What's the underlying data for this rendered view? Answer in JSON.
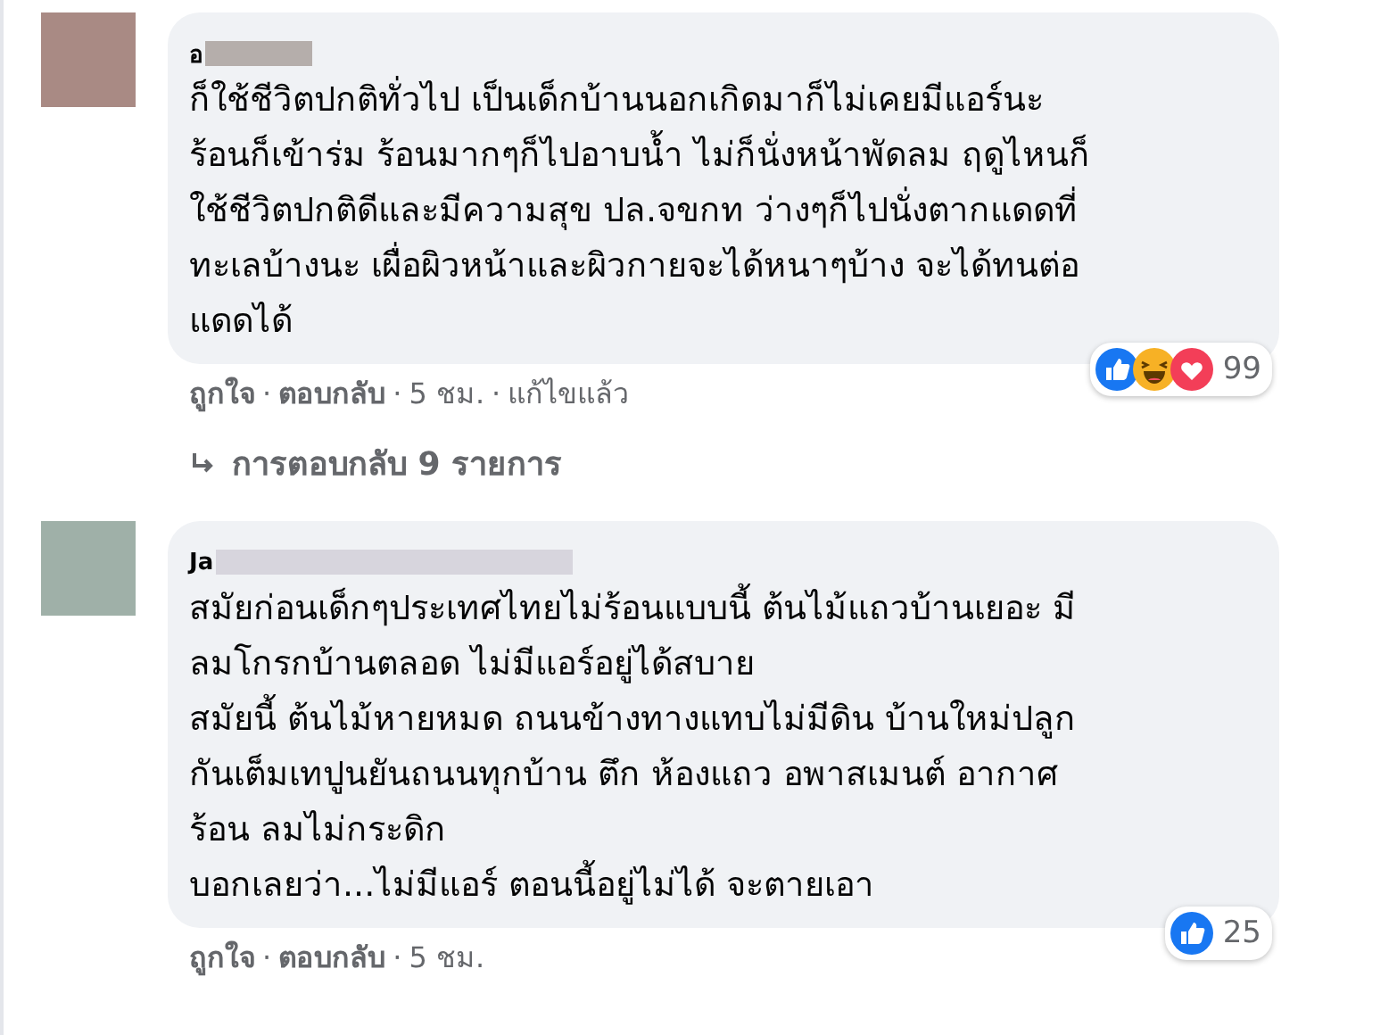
{
  "comments": [
    {
      "author": "อ",
      "lines": [
        "ก็ใช้ชีวิตปกติทั่วไป เป็นเด็กบ้านนอกเกิดมาก็ไม่เคยมีแอร์นะ",
        "ร้อนก็เข้าร่ม ร้อนมากๆก็ไปอาบน้ำ ไม่ก็นั่งหน้าพัดลม ฤดูไหนก็",
        "ใช้ชีวิตปกติดีและมีความสุข ปล.จขกท ว่างๆก็ไปนั่งตากแดดที่",
        "ทะเลบ้างนะ เผื่อผิวหน้าและผิวกายจะได้หนาๆบ้าง จะได้ทนต่อ",
        "แดดได้"
      ],
      "actions": [
        "ถูกใจ",
        "ตอบกลับ",
        "5 ชม.",
        "แก้ไขแล้ว"
      ],
      "separator": "·",
      "reactions": [
        {
          "kind": "like"
        },
        {
          "kind": "haha"
        },
        {
          "kind": "love"
        }
      ],
      "reaction_count": "99",
      "replies_link": "การตอบกลับ 9 รายการ"
    },
    {
      "author": "Ja",
      "lines": [
        "สมัยก่อนเด็กๆประเทศไทยไม่ร้อนแบบนี้ ต้นไม้แถวบ้านเยอะ มี",
        "ลมโกรกบ้านตลอด ไม่มีแอร์อยู่ได้สบาย",
        "สมัยนี้ ต้นไม้หายหมด ถนนข้างทางแทบไม่มีดิน บ้านใหม่ปลูก",
        "กันเต็มเทปูนยันถนนทุกบ้าน ตึก ห้องแถว อพาสเมนต์ อากาศ",
        "ร้อน ลมไม่กระดิก",
        "บอกเลยว่า...ไม่มีแอร์ ตอนนี้อยู่ไม่ได้ จะตายเอา"
      ],
      "actions": [
        "ถูกใจ",
        "ตอบกลับ",
        "5 ชม."
      ],
      "separator": "·",
      "reactions": [
        {
          "kind": "like"
        }
      ],
      "reaction_count": "25"
    }
  ]
}
